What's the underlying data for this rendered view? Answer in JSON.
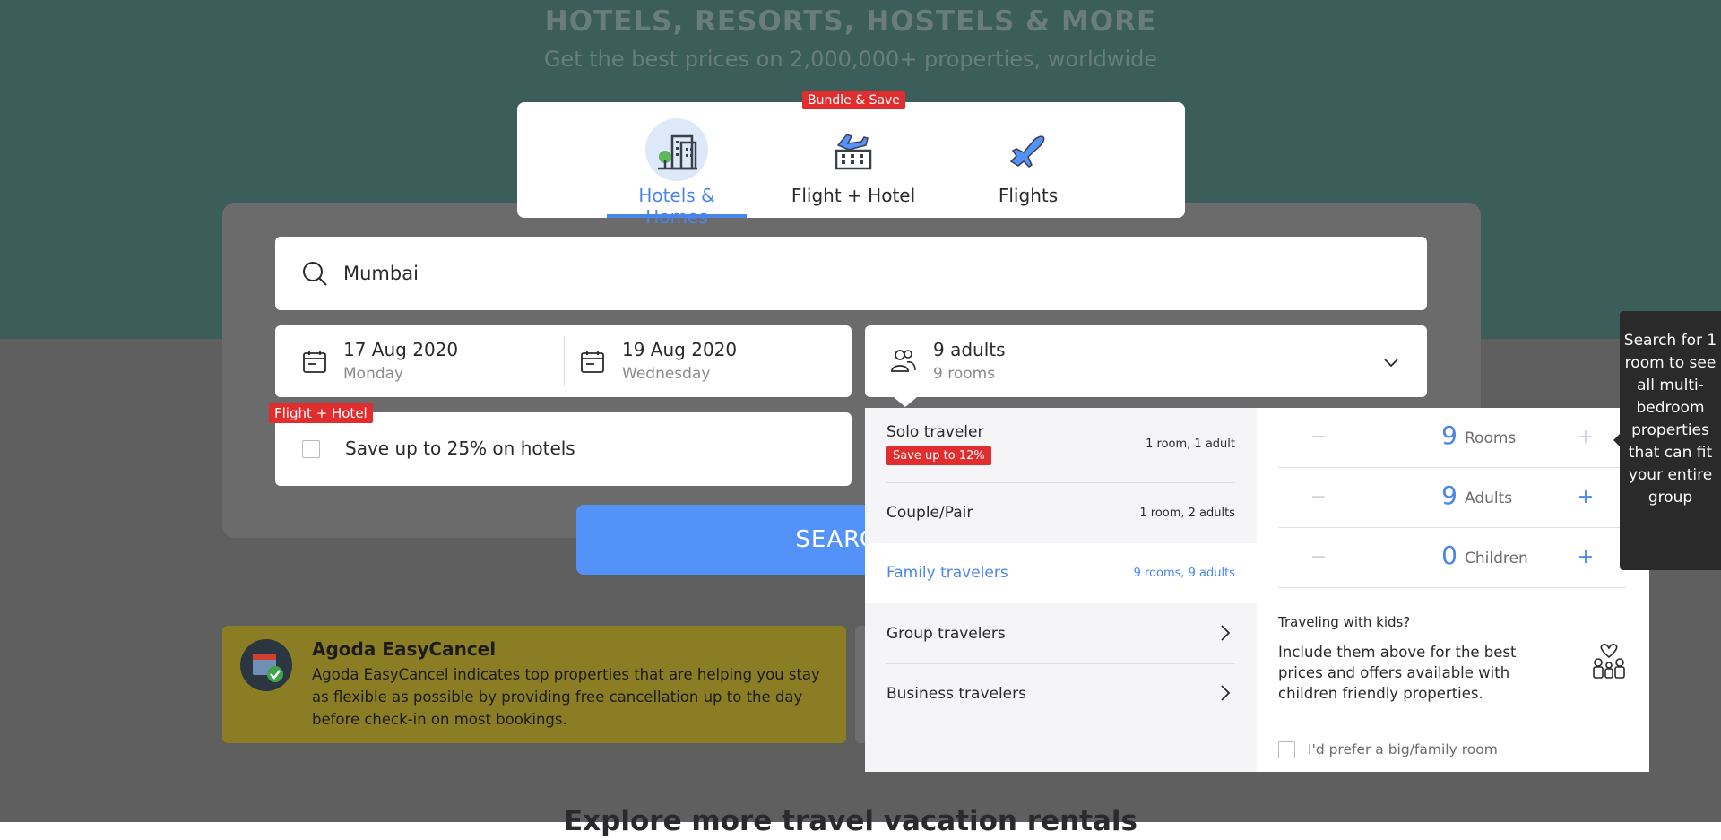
{
  "hero": {
    "title": "HOTELS, RESORTS, HOSTELS & MORE",
    "subtitle": "Get the best prices on 2,000,000+ properties, worldwide"
  },
  "tabs": [
    {
      "label": "Hotels & Homes",
      "icon": "hotel-building-icon",
      "active": true
    },
    {
      "label": "Flight + Hotel",
      "icon": "flight-hotel-icon",
      "badge": "Bundle & Save"
    },
    {
      "label": "Flights",
      "icon": "airplane-icon"
    }
  ],
  "search": {
    "value": "Mumbai",
    "icon": "search-icon"
  },
  "checkin": {
    "date": "17 Aug 2020",
    "day": "Monday",
    "icon": "calendar-icon"
  },
  "checkout": {
    "date": "19 Aug 2020",
    "day": "Wednesday",
    "icon": "calendar-icon"
  },
  "occupancy": {
    "main": "9 adults",
    "sub": "9 rooms",
    "icon": "people-icon"
  },
  "bundle": {
    "badge": "Flight + Hotel",
    "label": "Save up to 25% on hotels",
    "checked": false
  },
  "search_button": {
    "label": "SEARCH"
  },
  "easycancel": {
    "title": "Agoda EasyCancel",
    "body": "Agoda EasyCancel indicates top properties that are helping you stay as flexible as possible by providing free cancellation up to the day before check-in on most bookings.",
    "icon": "calendar-check-icon"
  },
  "explore": {
    "title": "Explore more travel vacation rentals"
  },
  "traveler_types": [
    {
      "label": "Solo traveler",
      "summary": "1 room, 1 adult",
      "badge": "Save up to 12%"
    },
    {
      "label": "Couple/Pair",
      "summary": "1 room, 2 adults"
    },
    {
      "label": "Family travelers",
      "summary": "9 rooms, 9 adults",
      "selected": true
    },
    {
      "label": "Group travelers",
      "chevron": true
    },
    {
      "label": "Business travelers",
      "chevron": true
    }
  ],
  "counters": [
    {
      "label": "Rooms",
      "value": "9",
      "minus": "−",
      "plus": "+"
    },
    {
      "label": "Adults",
      "value": "9",
      "minus": "−",
      "plus": "+"
    },
    {
      "label": "Children",
      "value": "0",
      "minus": "−",
      "plus": "+"
    }
  ],
  "kids": {
    "title": "Traveling with kids?",
    "body": "Include them above for the best prices and offers available with children friendly properties.",
    "icon": "family-heart-icon"
  },
  "family_room": {
    "label": "I'd prefer a big/family room",
    "checked": false
  },
  "tooltip": {
    "text": "Search for 1 room to see all multi-bedroom properties that can fit your entire group"
  },
  "colors": {
    "accent": "#4a86e8",
    "badge": "#e12d2d",
    "hero": "#3b5e5b"
  }
}
